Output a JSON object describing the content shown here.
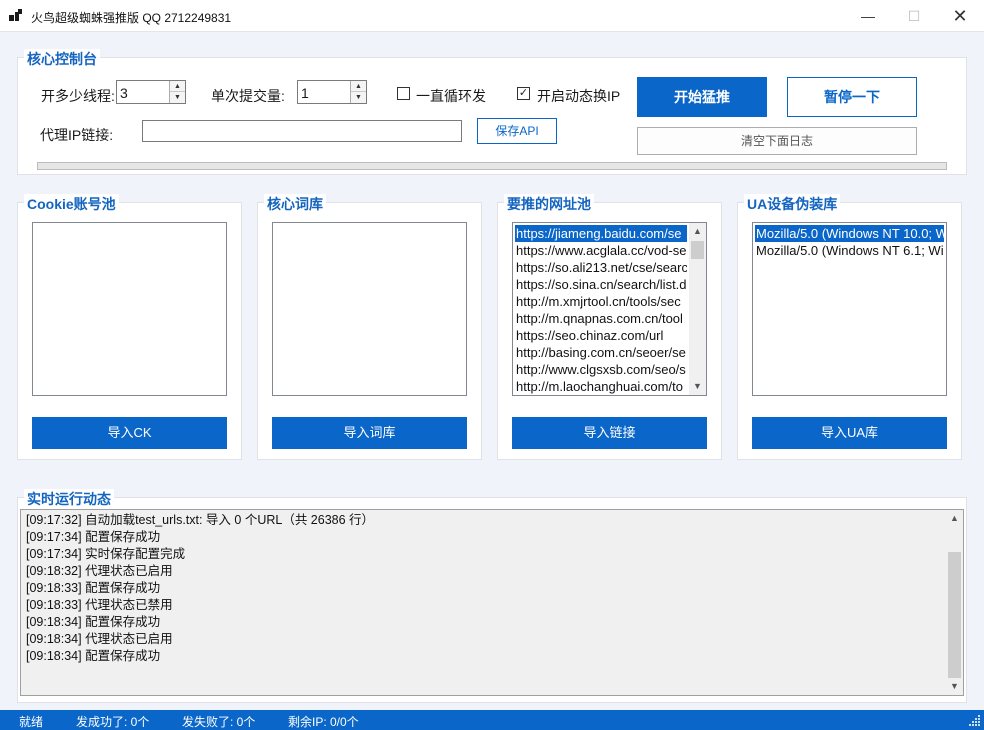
{
  "window": {
    "title": "火鸟超级蜘蛛强推版 QQ 2712249831",
    "minimize": "—",
    "maximize": "☐",
    "close": "✕"
  },
  "control": {
    "title": "核心控制台",
    "threads_label": "开多少线程:",
    "threads_value": "3",
    "batch_label": "单次提交量:",
    "batch_value": "1",
    "loop_label": "一直循环发",
    "loop_checked": false,
    "dynamic_ip_label": "开启动态换IP",
    "dynamic_ip_checked": true,
    "start_button": "开始猛推",
    "pause_button": "暂停一下",
    "proxy_label": "代理IP链接:",
    "proxy_value": "",
    "save_api_button": "保存API",
    "clear_log_button": "清空下面日志",
    "progress": 0
  },
  "pools": {
    "cookie": {
      "title": "Cookie账号池",
      "button": "导入CK",
      "items": []
    },
    "words": {
      "title": "核心词库",
      "button": "导入词库",
      "items": []
    },
    "urls": {
      "title": "要推的网址池",
      "button": "导入链接",
      "items": [
        "https://jiameng.baidu.com/se",
        "https://www.acglala.cc/vod-se",
        "https://so.ali213.net/cse/searc",
        "https://so.sina.cn/search/list.d",
        "http://m.xmjrtool.cn/tools/sec",
        "http://m.qnapnas.com.cn/tool",
        "https://seo.chinaz.com/url",
        "http://basing.com.cn/seoer/se",
        "http://www.clgsxsb.com/seo/s",
        "http://m.laochanghuai.com/to"
      ]
    },
    "ua": {
      "title": "UA设备伪装库",
      "button": "导入UA库",
      "items": [
        "Mozilla/5.0 (Windows NT 10.0; W",
        "Mozilla/5.0 (Windows NT 6.1; Wi"
      ]
    }
  },
  "log": {
    "title": "实时运行动态",
    "lines": [
      "[09:17:32] 自动加载test_urls.txt: 导入 0 个URL（共 26386 行）",
      "[09:17:34] 配置保存成功",
      "[09:17:34] 实时保存配置完成",
      "[09:18:32] 代理状态已启用",
      "[09:18:33] 配置保存成功",
      "[09:18:33] 代理状态已禁用",
      "[09:18:34] 配置保存成功",
      "[09:18:34] 代理状态已启用",
      "[09:18:34] 配置保存成功"
    ]
  },
  "status": {
    "ready": "就绪",
    "success": "发成功了: 0个",
    "fail": "发失败了: 0个",
    "remaining_ip": "剩余IP: 0/0个"
  },
  "colors": {
    "accent": "#0a66c8",
    "heading": "#1565c0",
    "background": "#f0f4fa"
  }
}
